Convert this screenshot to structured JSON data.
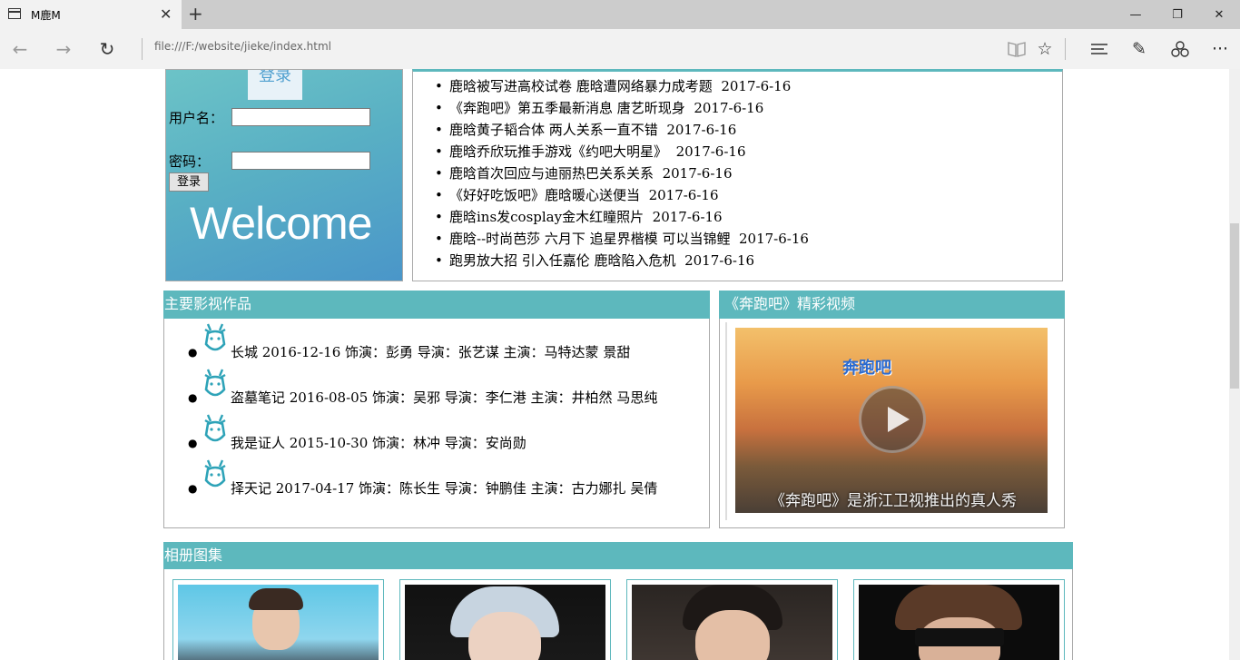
{
  "browser": {
    "tab_title": "M鹿M",
    "tab_close": "✕",
    "new_tab": "+",
    "url": "file:///F:/website/jieke/index.html",
    "window": {
      "minimize": "—",
      "restore": "❐",
      "close": "✕"
    },
    "nav": {
      "back": "←",
      "forward": "→",
      "refresh": "↻"
    },
    "tools": {
      "reading": "📖",
      "favorite": "☆",
      "hub": "≡",
      "note": "✎",
      "share": "⌂",
      "more": "···"
    }
  },
  "login": {
    "logo_text": "登录",
    "username_label": "用户名：",
    "password_label": "密码：",
    "button_label": "登录",
    "welcome": "Welcome"
  },
  "news": [
    {
      "title": "鹿晗被写进高校试卷 鹿晗遭网络暴力成考题",
      "date": "2017-6-16"
    },
    {
      "title": "《奔跑吧》第五季最新消息 唐艺昕现身",
      "date": "2017-6-16"
    },
    {
      "title": "鹿晗黄子韬合体 两人关系一直不错",
      "date": "2017-6-16"
    },
    {
      "title": "鹿晗乔欣玩推手游戏《约吧大明星》",
      "date": "2017-6-16"
    },
    {
      "title": "鹿晗首次回应与迪丽热巴关系关系",
      "date": "2017-6-16"
    },
    {
      "title": "《好好吃饭吧》鹿晗暖心送便当",
      "date": "2017-6-16"
    },
    {
      "title": "鹿晗ins发cosplay金木红瞳照片",
      "date": "2017-6-16"
    },
    {
      "title": "鹿晗--时尚芭莎 六月下 追星界楷模 可以当锦鲤",
      "date": "2017-6-16"
    },
    {
      "title": "跑男放大招 引入任嘉伦 鹿晗陷入危机",
      "date": "2017-6-16"
    }
  ],
  "works": {
    "heading": "主要影视作品",
    "items": [
      {
        "text": "长城 2016-12-16 饰演：彭勇 导演：张艺谋 主演：马特达蒙 景甜"
      },
      {
        "text": "盗墓笔记 2016-08-05 饰演：吴邪 导演：李仁港 主演：井柏然 马思纯"
      },
      {
        "text": "我是证人 2015-10-30 饰演：林冲 导演：安尚勋"
      },
      {
        "text": "择天记 2017-04-17 饰演：陈长生 导演：钟鹏佳 主演：古力娜扎 吴倩"
      }
    ],
    "icon": "deer-icon"
  },
  "video": {
    "heading": "《奔跑吧》精彩视频",
    "poster_logo": "奔跑吧",
    "caption": "《奔跑吧》是浙江卫视推出的真人秀"
  },
  "album": {
    "heading": "相册图集",
    "photos": [
      "photo-1",
      "photo-2",
      "photo-3",
      "photo-4"
    ]
  },
  "colors": {
    "accent": "#5db8bd",
    "chrome": "#f2f2f2",
    "tabbar": "#cccccc"
  }
}
